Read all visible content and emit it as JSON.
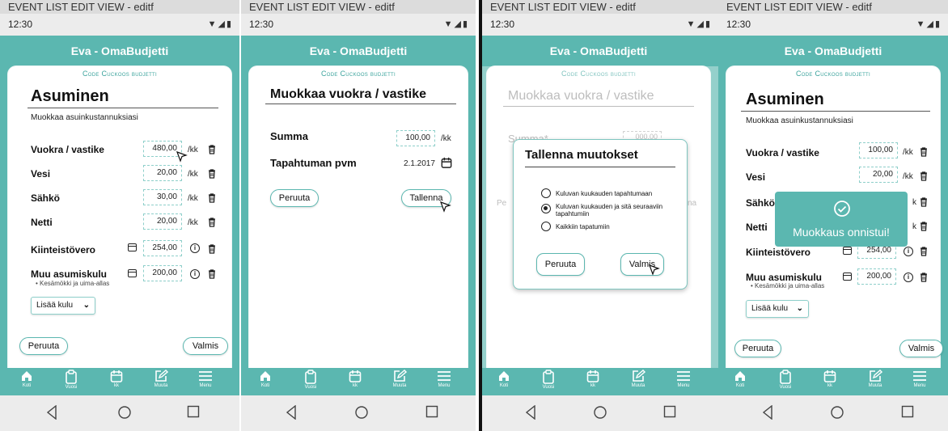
{
  "window_title": "EVENT LIST EDIT VIEW - editf",
  "status_time": "12:30",
  "app_title": "Eva - OmaBudjetti",
  "subtitle": "Code Cuckoos budjetti",
  "nav": [
    {
      "label": "Koti",
      "icon": "home-icon"
    },
    {
      "label": "Vuosi",
      "icon": "clipboard-icon"
    },
    {
      "label": "kk",
      "icon": "calendar-icon"
    },
    {
      "label": "Muuta",
      "icon": "edit-icon"
    },
    {
      "label": "Menu",
      "icon": "menu-icon"
    }
  ],
  "screen1": {
    "heading": "Asuminen",
    "description": "Muokkaa asuinkustannuksiasi",
    "rows": [
      {
        "label": "Vuokra / vastike",
        "value": "480,00",
        "unit": "/kk"
      },
      {
        "label": "Vesi",
        "value": "20,00",
        "unit": "/kk"
      },
      {
        "label": "Sähkö",
        "value": "30,00",
        "unit": "/kk"
      },
      {
        "label": "Netti",
        "value": "20,00",
        "unit": "/kk"
      },
      {
        "label": "Kiinteistövero",
        "value": "254,00"
      },
      {
        "label": "Muu asumiskulu",
        "value": "200,00",
        "note": "• Kesämökki ja uima-allas"
      }
    ],
    "add_dropdown": "Lisää kulu",
    "cancel": "Peruuta",
    "done": "Valmis"
  },
  "screen2": {
    "heading": "Muokkaa vuokra / vastike",
    "sum_label": "Summa",
    "sum_value": "100,00",
    "sum_unit": "/kk",
    "date_label": "Tapahtuman pvm",
    "date_value": "2.1.2017",
    "cancel": "Peruuta",
    "save": "Tallenna"
  },
  "screen3": {
    "heading": "Muokkaa vuokra / vastike",
    "sum_label_ghost": "Summa*",
    "sum_value_ghost": "000,00",
    "ghost_cancel": "Pe",
    "ghost_save": "na",
    "dialog_title": "Tallenna muutokset",
    "options": [
      {
        "label": "Kuluvan kuukauden tapahtumaan",
        "selected": false
      },
      {
        "label": "Kuluvan kuukauden ja sitä seuraaviin tapahtumiin",
        "selected": true
      },
      {
        "label": "Kaikkiin tapatumiin",
        "selected": false
      }
    ],
    "cancel": "Peruuta",
    "done": "Valmis"
  },
  "screen4": {
    "heading": "Asuminen",
    "description": "Muokkaa asuinkustannuksiasi",
    "rows": [
      {
        "label": "Vuokra / vastike",
        "value": "100,00",
        "unit": "/kk"
      },
      {
        "label": "Vesi",
        "value": "20,00",
        "unit": "/kk"
      },
      {
        "label": "Sähkö",
        "unit": "k"
      },
      {
        "label": "Netti",
        "unit": "k"
      },
      {
        "label": "Kiinteistövero",
        "value": "254,00"
      },
      {
        "label": "Muu asumiskulu",
        "value": "200,00",
        "note": "• Kesämökki ja uima-allas"
      }
    ],
    "add_dropdown": "Lisää kulu",
    "cancel": "Peruuta",
    "done": "Valmis",
    "toast": "Muokkaus onnistui!"
  },
  "colors": {
    "accent": "#5bb7b0",
    "accent_light": "#8ecfca"
  }
}
